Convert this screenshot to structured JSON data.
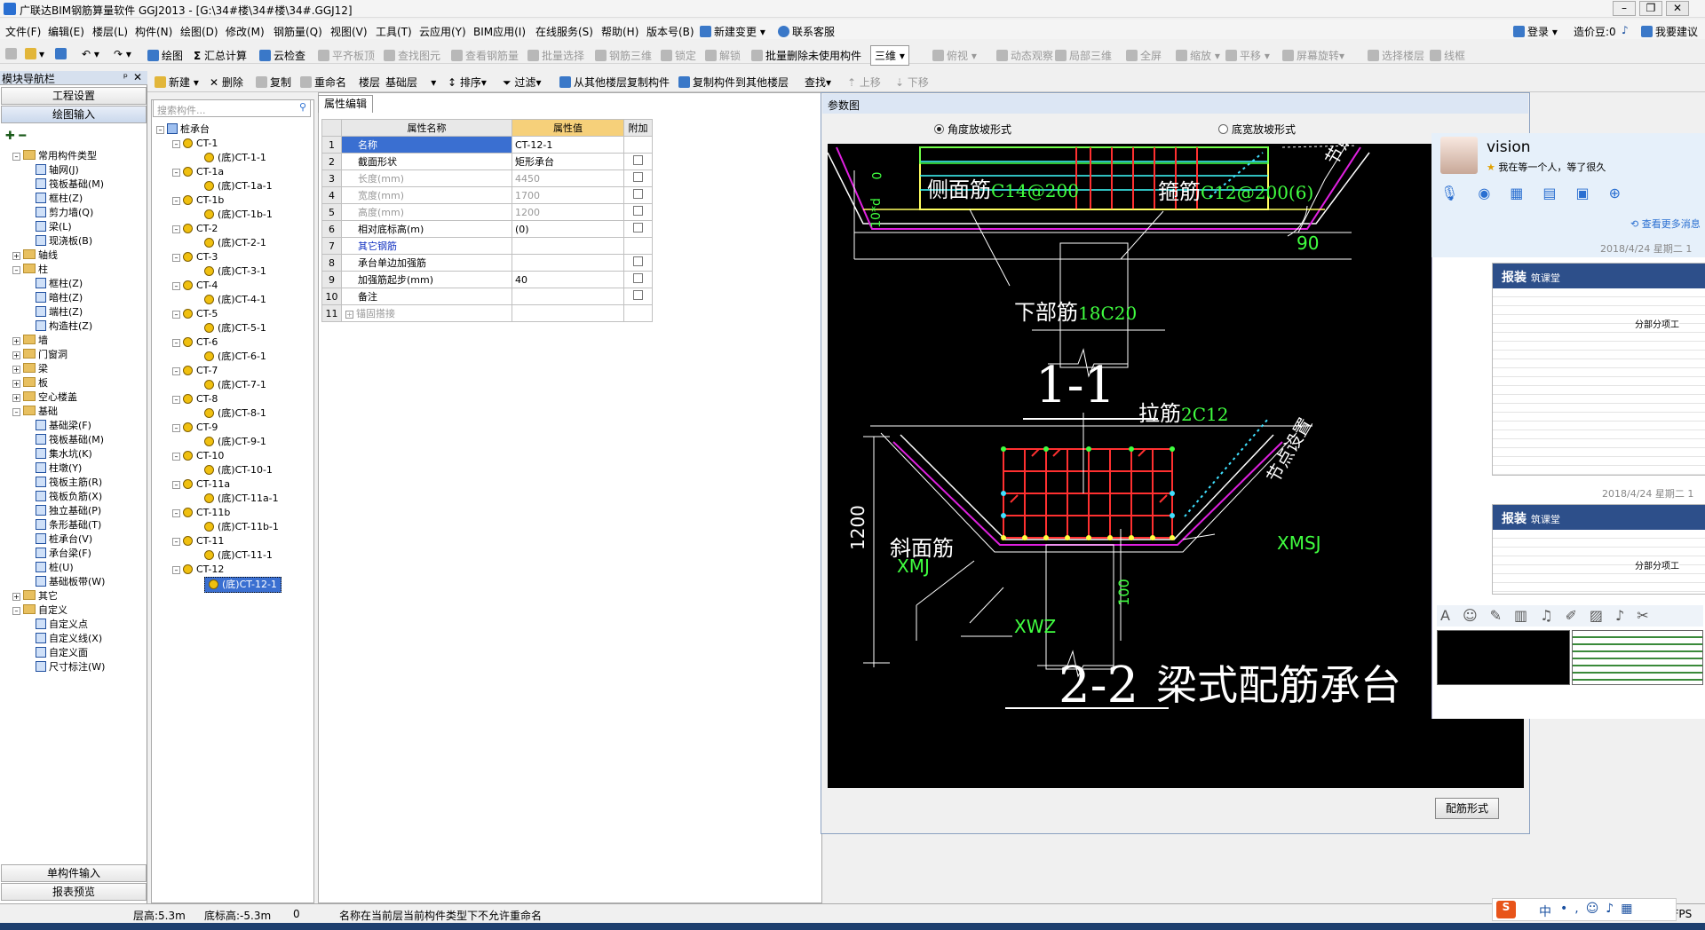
{
  "window": {
    "title": "广联达BIM钢筋算量软件 GGJ2013 - [G:\\34#楼\\34#楼\\34#.GGJ12]"
  },
  "menu": [
    "文件(F)",
    "编辑(E)",
    "楼层(L)",
    "构件(N)",
    "绘图(D)",
    "修改(M)",
    "钢筋量(Q)",
    "视图(V)",
    "工具(T)",
    "云应用(Y)",
    "BIM应用(I)",
    "在线服务(S)",
    "帮助(H)",
    "版本号(B)",
    "新建变更",
    "联系客服"
  ],
  "menu_right": {
    "login": "登录",
    "beans": "造价豆:0",
    "wish": "我要建议"
  },
  "toolbar1": [
    "绘图",
    "汇总计算",
    "云检查",
    "平齐板顶",
    "查找图元",
    "查看钢筋量",
    "批量选择",
    "钢筋三维",
    "锁定",
    "解锁",
    "批量删除未使用构件",
    "三维",
    "俯视",
    "动态观察",
    "局部三维",
    "全屏",
    "缩放",
    "平移",
    "屏幕旋转",
    "选择楼层",
    "线框"
  ],
  "toolbar2": [
    "新建",
    "删除",
    "复制",
    "重命名",
    "楼层",
    "基础层",
    "排序",
    "过滤",
    "从其他楼层复制构件",
    "复制构件到其他楼层",
    "查找",
    "上移",
    "下移"
  ],
  "nav": {
    "title": "模块导航栏",
    "top_buttons": [
      "工程设置",
      "绘图输入"
    ],
    "bottom_buttons": [
      "单构件输入",
      "报表预览"
    ],
    "tree": [
      {
        "level": 0,
        "label": "常用构件类型",
        "folder": true,
        "open": true
      },
      {
        "level": 1,
        "label": "轴网(J)"
      },
      {
        "level": 1,
        "label": "筏板基础(M)"
      },
      {
        "level": 1,
        "label": "框柱(Z)"
      },
      {
        "level": 1,
        "label": "剪力墙(Q)"
      },
      {
        "level": 1,
        "label": "梁(L)"
      },
      {
        "level": 1,
        "label": "现浇板(B)"
      },
      {
        "level": 0,
        "label": "轴线",
        "folder": true
      },
      {
        "level": 0,
        "label": "柱",
        "folder": true,
        "open": true
      },
      {
        "level": 1,
        "label": "框柱(Z)"
      },
      {
        "level": 1,
        "label": "暗柱(Z)"
      },
      {
        "level": 1,
        "label": "端柱(Z)"
      },
      {
        "level": 1,
        "label": "构造柱(Z)"
      },
      {
        "level": 0,
        "label": "墙",
        "folder": true
      },
      {
        "level": 0,
        "label": "门窗洞",
        "folder": true
      },
      {
        "level": 0,
        "label": "梁",
        "folder": true
      },
      {
        "level": 0,
        "label": "板",
        "folder": true
      },
      {
        "level": 0,
        "label": "空心楼盖",
        "folder": true
      },
      {
        "level": 0,
        "label": "基础",
        "folder": true,
        "open": true
      },
      {
        "level": 1,
        "label": "基础梁(F)"
      },
      {
        "level": 1,
        "label": "筏板基础(M)"
      },
      {
        "level": 1,
        "label": "集水坑(K)"
      },
      {
        "level": 1,
        "label": "柱墩(Y)"
      },
      {
        "level": 1,
        "label": "筏板主筋(R)"
      },
      {
        "level": 1,
        "label": "筏板负筋(X)"
      },
      {
        "level": 1,
        "label": "独立基础(P)"
      },
      {
        "level": 1,
        "label": "条形基础(T)"
      },
      {
        "level": 1,
        "label": "桩承台(V)"
      },
      {
        "level": 1,
        "label": "承台梁(F)"
      },
      {
        "level": 1,
        "label": "桩(U)"
      },
      {
        "level": 1,
        "label": "基础板带(W)"
      },
      {
        "level": 0,
        "label": "其它",
        "folder": true
      },
      {
        "level": 0,
        "label": "自定义",
        "folder": true,
        "open": true
      },
      {
        "level": 1,
        "label": "自定义点"
      },
      {
        "level": 1,
        "label": "自定义线(X)"
      },
      {
        "level": 1,
        "label": "自定义面"
      },
      {
        "level": 1,
        "label": "尺寸标注(W)"
      }
    ]
  },
  "components": {
    "search_placeholder": "搜索构件...",
    "root": "桩承台",
    "items": [
      {
        "name": "CT-1",
        "child": "(底)CT-1-1"
      },
      {
        "name": "CT-1a",
        "child": "(底)CT-1a-1"
      },
      {
        "name": "CT-1b",
        "child": "(底)CT-1b-1"
      },
      {
        "name": "CT-2",
        "child": "(底)CT-2-1"
      },
      {
        "name": "CT-3",
        "child": "(底)CT-3-1"
      },
      {
        "name": "CT-4",
        "child": "(底)CT-4-1"
      },
      {
        "name": "CT-5",
        "child": "(底)CT-5-1"
      },
      {
        "name": "CT-6",
        "child": "(底)CT-6-1"
      },
      {
        "name": "CT-7",
        "child": "(底)CT-7-1"
      },
      {
        "name": "CT-8",
        "child": "(底)CT-8-1"
      },
      {
        "name": "CT-9",
        "child": "(底)CT-9-1"
      },
      {
        "name": "CT-10",
        "child": "(底)CT-10-1"
      },
      {
        "name": "CT-11a",
        "child": "(底)CT-11a-1"
      },
      {
        "name": "CT-11b",
        "child": "(底)CT-11b-1"
      },
      {
        "name": "CT-11",
        "child": "(底)CT-11-1"
      },
      {
        "name": "CT-12",
        "child": "(底)CT-12-1"
      }
    ]
  },
  "properties": {
    "tab": "属性编辑",
    "headers": [
      "属性名称",
      "属性值",
      "附加"
    ],
    "rows": [
      {
        "n": "1",
        "name": "名称",
        "value": "CT-12-1",
        "style": "sel"
      },
      {
        "n": "2",
        "name": "截面形状",
        "value": "矩形承台",
        "style": "",
        "cb": true
      },
      {
        "n": "3",
        "name": "长度(mm)",
        "value": "4450",
        "style": "gr",
        "cb": true
      },
      {
        "n": "4",
        "name": "宽度(mm)",
        "value": "1700",
        "style": "gr",
        "cb": true
      },
      {
        "n": "5",
        "name": "高度(mm)",
        "value": "1200",
        "style": "gr",
        "cb": true
      },
      {
        "n": "6",
        "name": "相对底标高(m)",
        "value": "(0)",
        "style": "",
        "cb": true
      },
      {
        "n": "7",
        "name": "其它钢筋",
        "value": "",
        "style": "bl"
      },
      {
        "n": "8",
        "name": "承台单边加强筋",
        "value": "",
        "style": "",
        "cb": true
      },
      {
        "n": "9",
        "name": "加强筋起步(mm)",
        "value": "40",
        "style": "",
        "cb": true
      },
      {
        "n": "10",
        "name": "备注",
        "value": "",
        "style": "",
        "cb": true
      },
      {
        "n": "11",
        "name": "锚固搭接",
        "value": "",
        "style": "gr"
      }
    ]
  },
  "param_window": {
    "title": "参数图",
    "radio1": "角度放坡形式",
    "radio2": "底宽放坡形式",
    "config_button": "配筋形式",
    "cad": {
      "side_bar": "侧面筋",
      "side_spec": "C14@200",
      "stirrup": "箍筋",
      "stirrup_spec": "C12@200(6)",
      "bottom": "下部筋",
      "bottom_spec": "18C20",
      "node": "节点设置",
      "angle": "90",
      "dim_0": "0",
      "dim_10d": "10*d",
      "sec1": "1-1",
      "tie": "拉筋",
      "tie_spec": "2C12",
      "slope": "斜面筋",
      "xmj": "XMJ",
      "xmsj": "XMSJ",
      "xwz": "XWZ",
      "dim_1200": "1200",
      "dim_100": "100",
      "sec2": "2-2",
      "caption": "梁式配筋承台"
    }
  },
  "chat": {
    "name": "vision",
    "status": "我在等一个人，等了很久",
    "more": "查看更多消息",
    "date1": "2018/4/24 星期二 1",
    "date2": "2018/4/24 星期二 1",
    "thumb_title": "报装",
    "thumb_sub": "筑课堂",
    "thumb_table": "分部分项工"
  },
  "status": {
    "floor_h": "层高:5.3m",
    "base_h": "底标高:-5.3m",
    "zero": "0",
    "msg": "名称在当前层当前构件类型下不允许重命名",
    "fps": "2 FPS"
  },
  "ime": {
    "lang": "中"
  }
}
